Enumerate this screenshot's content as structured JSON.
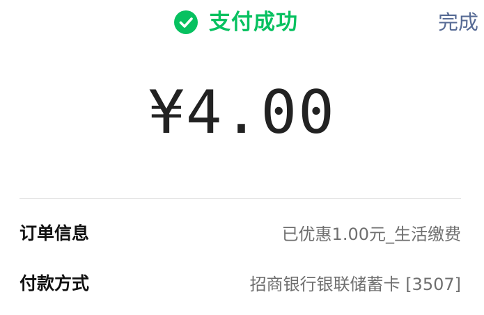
{
  "header": {
    "status_text": "支付成功",
    "status_icon": "check-circle-icon",
    "done_label": "完成"
  },
  "payment": {
    "amount": "¥4.00"
  },
  "details": [
    {
      "label": "订单信息",
      "value": "已优惠1.00元_生活缴费"
    },
    {
      "label": "付款方式",
      "value": "招商银行银联储蓄卡 [3507]"
    }
  ],
  "colors": {
    "success": "#07c160",
    "link": "#576b95",
    "amount": "#222222",
    "secondary_text": "#6f6f6f",
    "divider": "#e5e5e5"
  }
}
